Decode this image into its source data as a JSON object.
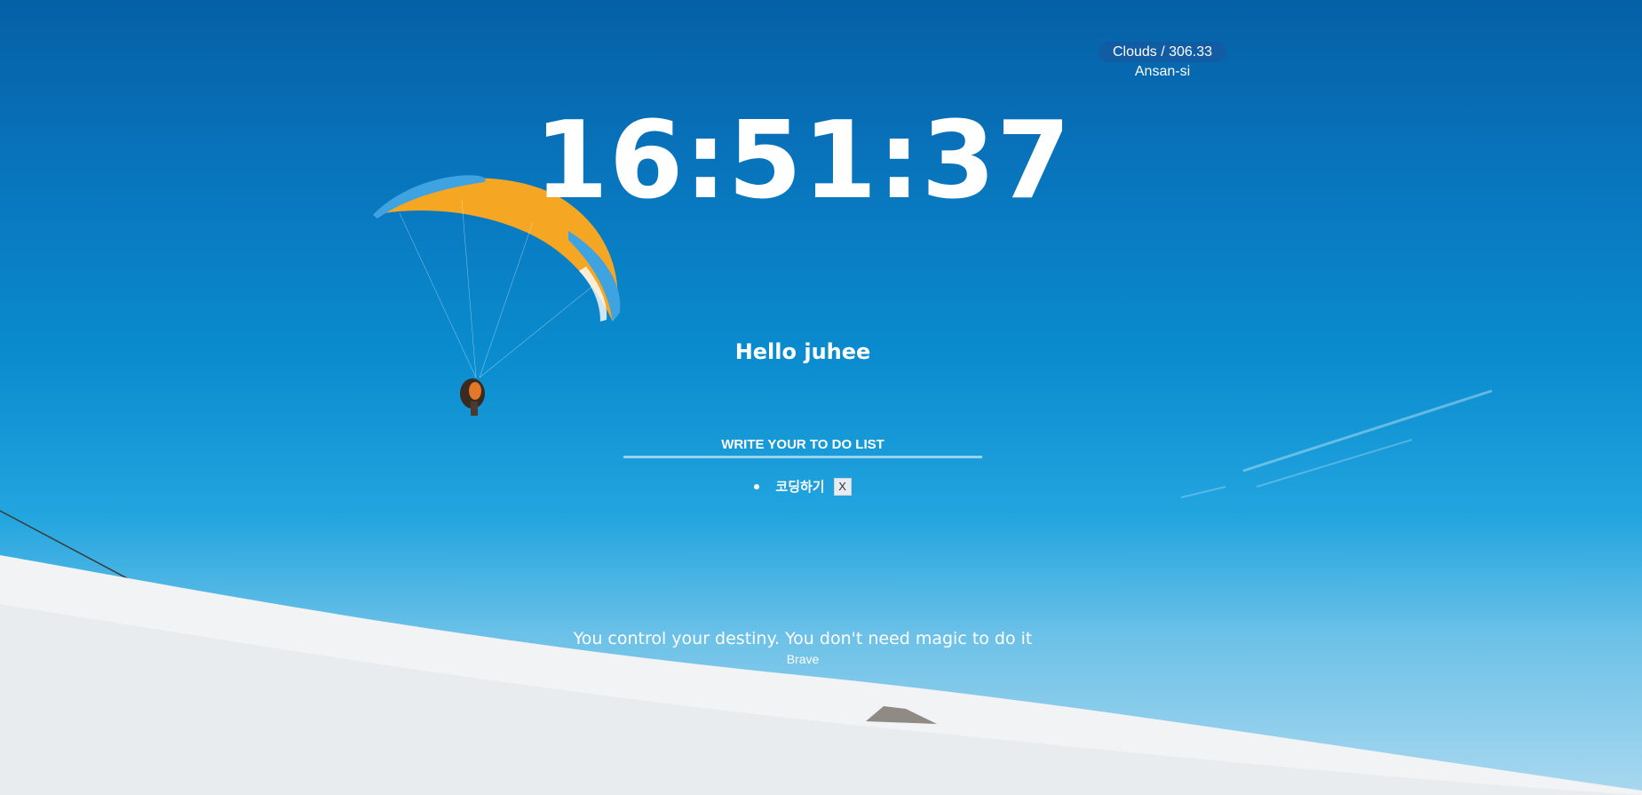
{
  "weather": {
    "condition_temp": "Clouds / 306.33",
    "city": "Ansan-si"
  },
  "clock": {
    "time": "16:51:37"
  },
  "greeting": {
    "text": "Hello juhee"
  },
  "todo": {
    "placeholder": "WRITE YOUR TO DO LIST",
    "items": [
      {
        "text": "코딩하기",
        "delete_label": "X"
      }
    ]
  },
  "quote": {
    "text": "You control your destiny. You don't need magic to do it",
    "author": "Brave"
  },
  "colors": {
    "sky_top": "#0560a6",
    "sky_bottom": "#a9d8ef",
    "text": "#ffffff",
    "glider_orange": "#f5a623",
    "glider_blue": "#3ea3e0",
    "snow": "#f1f3f4"
  }
}
